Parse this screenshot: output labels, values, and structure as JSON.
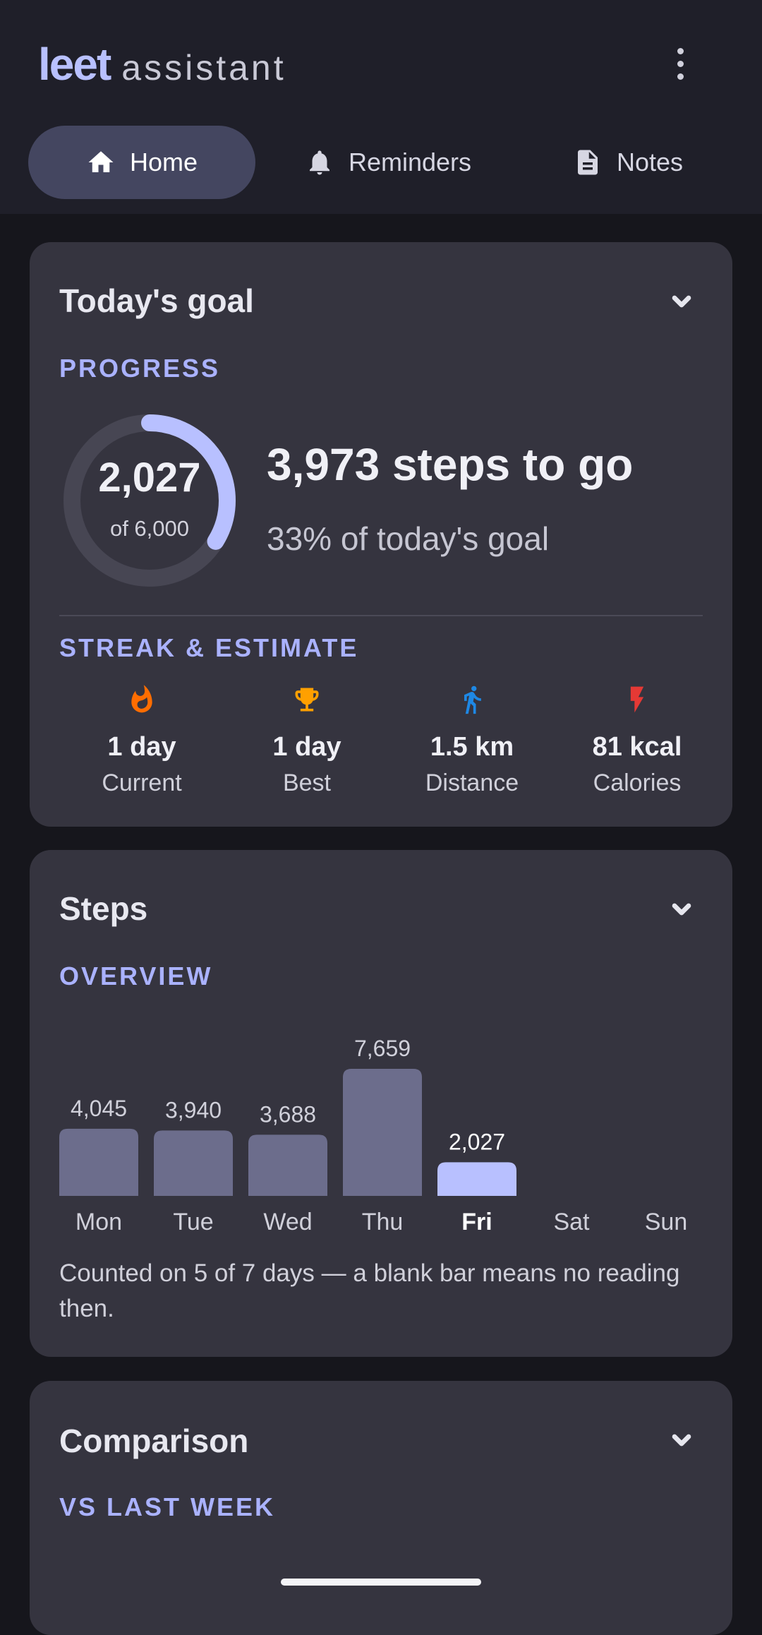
{
  "app": {
    "brand_bold": "leet",
    "brand_light": "assistant"
  },
  "tabs": [
    {
      "label": "Home",
      "icon": "home-icon",
      "active": true
    },
    {
      "label": "Reminders",
      "icon": "bell-icon",
      "active": false
    },
    {
      "label": "Notes",
      "icon": "document-icon",
      "active": false
    }
  ],
  "goal_card": {
    "title": "Today's goal",
    "progress_label": "PROGRESS",
    "steps_value": "2,027",
    "steps_sub": "of 6,000",
    "progress_fraction": 0.338,
    "to_go": "3,973 steps to go",
    "percent_text": "33% of today's goal",
    "streak_label": "STREAK & ESTIMATE",
    "stats": [
      {
        "value": "1 day",
        "label": "Current",
        "icon": "flame-icon",
        "color": "#ff6d00"
      },
      {
        "value": "1 day",
        "label": "Best",
        "icon": "trophy-icon",
        "color": "#ffa000"
      },
      {
        "value": "1.5 km",
        "label": "Distance",
        "icon": "walk-icon",
        "color": "#1e88e5"
      },
      {
        "value": "81 kcal",
        "label": "Calories",
        "icon": "bolt-icon",
        "color": "#e53935"
      }
    ]
  },
  "steps_card": {
    "title": "Steps",
    "overview_label": "OVERVIEW",
    "note": "Counted on 5 of 7 days — a blank bar means no reading then."
  },
  "chart_data": {
    "type": "bar",
    "categories": [
      "Mon",
      "Tue",
      "Wed",
      "Thu",
      "Fri",
      "Sat",
      "Sun"
    ],
    "values": [
      4045,
      3940,
      3688,
      7659,
      2027,
      null,
      null
    ],
    "value_labels": [
      "4,045",
      "3,940",
      "3,688",
      "7,659",
      "2,027",
      "",
      ""
    ],
    "highlight_index": 4,
    "colors": {
      "bar": "#6c6d8c",
      "highlight": "#b8c0ff"
    }
  },
  "comparison_card": {
    "title": "Comparison",
    "label": "VS LAST WEEK"
  },
  "colors": {
    "accent": "#b8c0ff",
    "card_bg": "#35343f",
    "ring_track": "#474653"
  }
}
